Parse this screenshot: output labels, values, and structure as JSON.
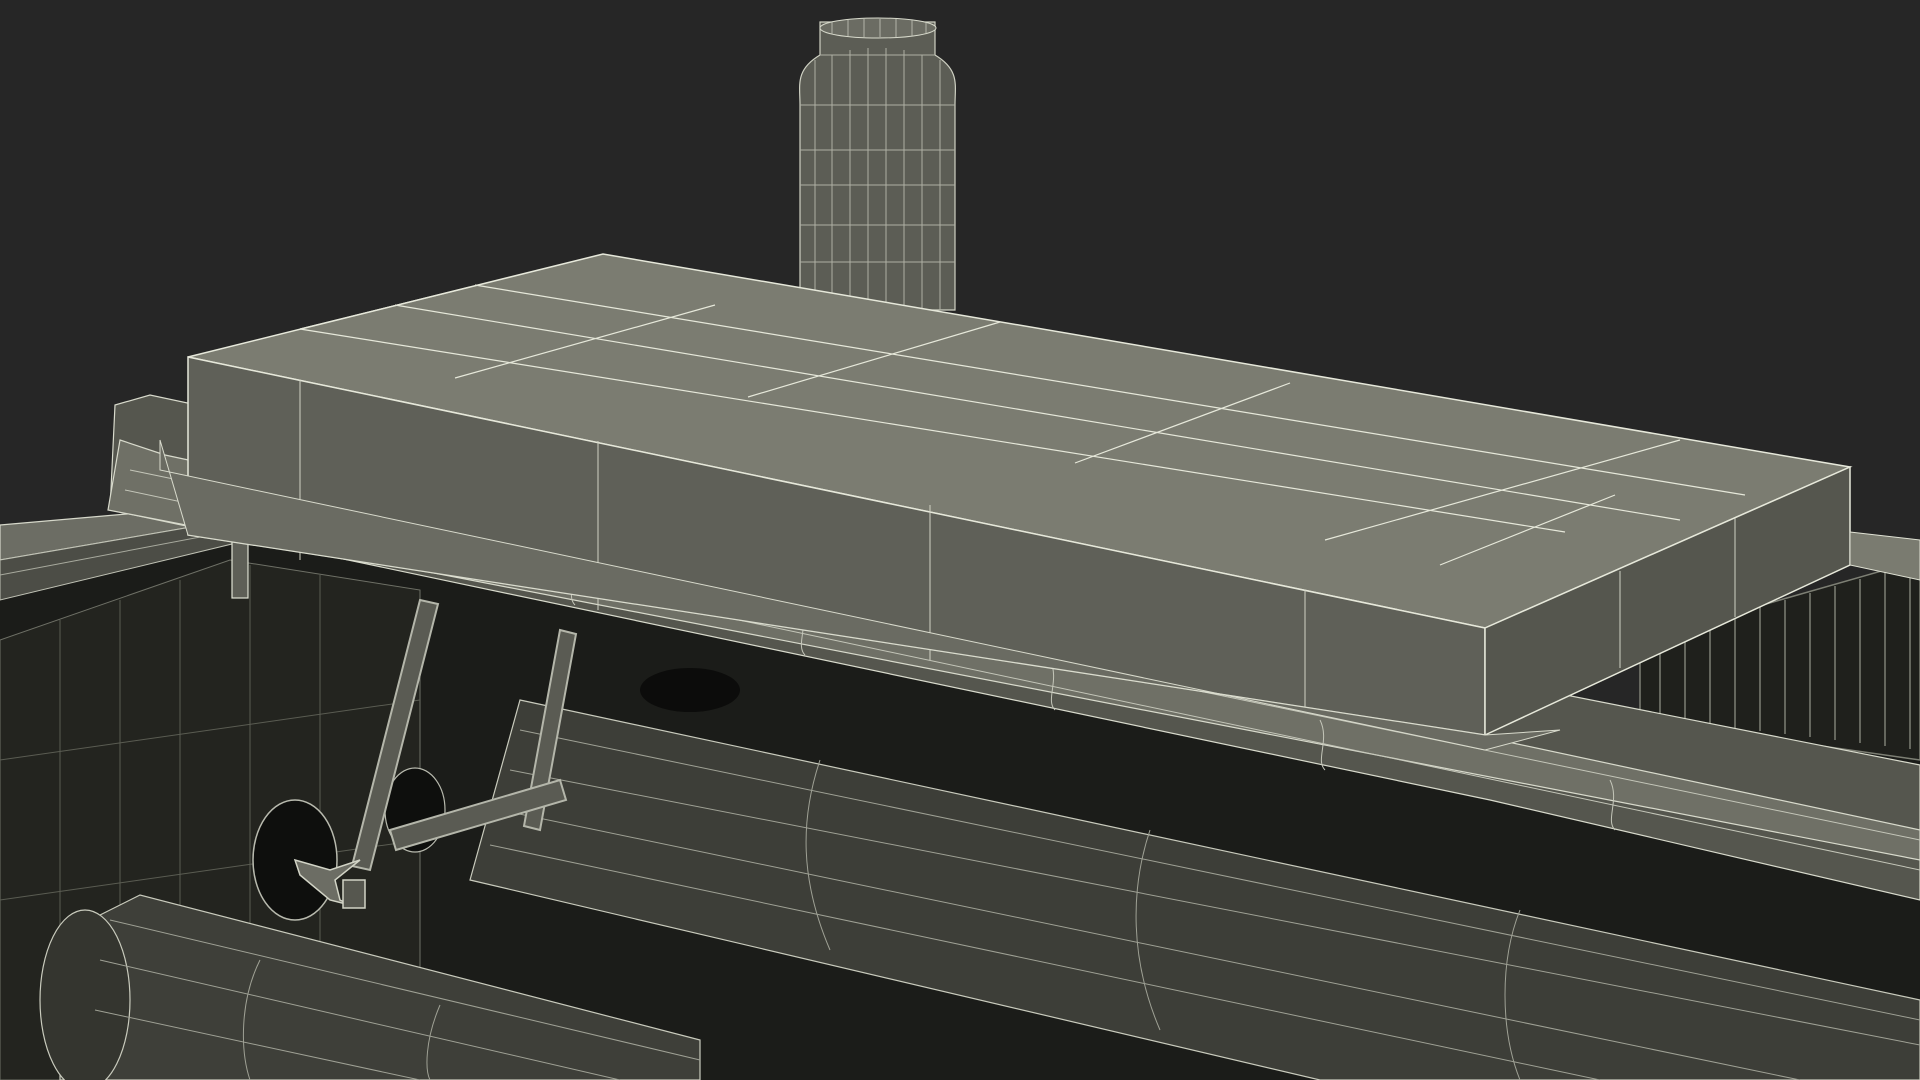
{
  "scene": {
    "subject": "wireframe-render",
    "colors": {
      "background": "#262626",
      "hull_dark": "#1c1d1a",
      "panel_top": "#7a7b70",
      "panel_front": "#5f6058",
      "panel_front_dark": "#4e4f48",
      "rail_top": "#6f7066",
      "rail_face": "#55564e",
      "canister": "#5d5e56",
      "pipe": "#3f403a",
      "wire": "#d8dacc",
      "wire_dim": "#8e9085"
    }
  }
}
